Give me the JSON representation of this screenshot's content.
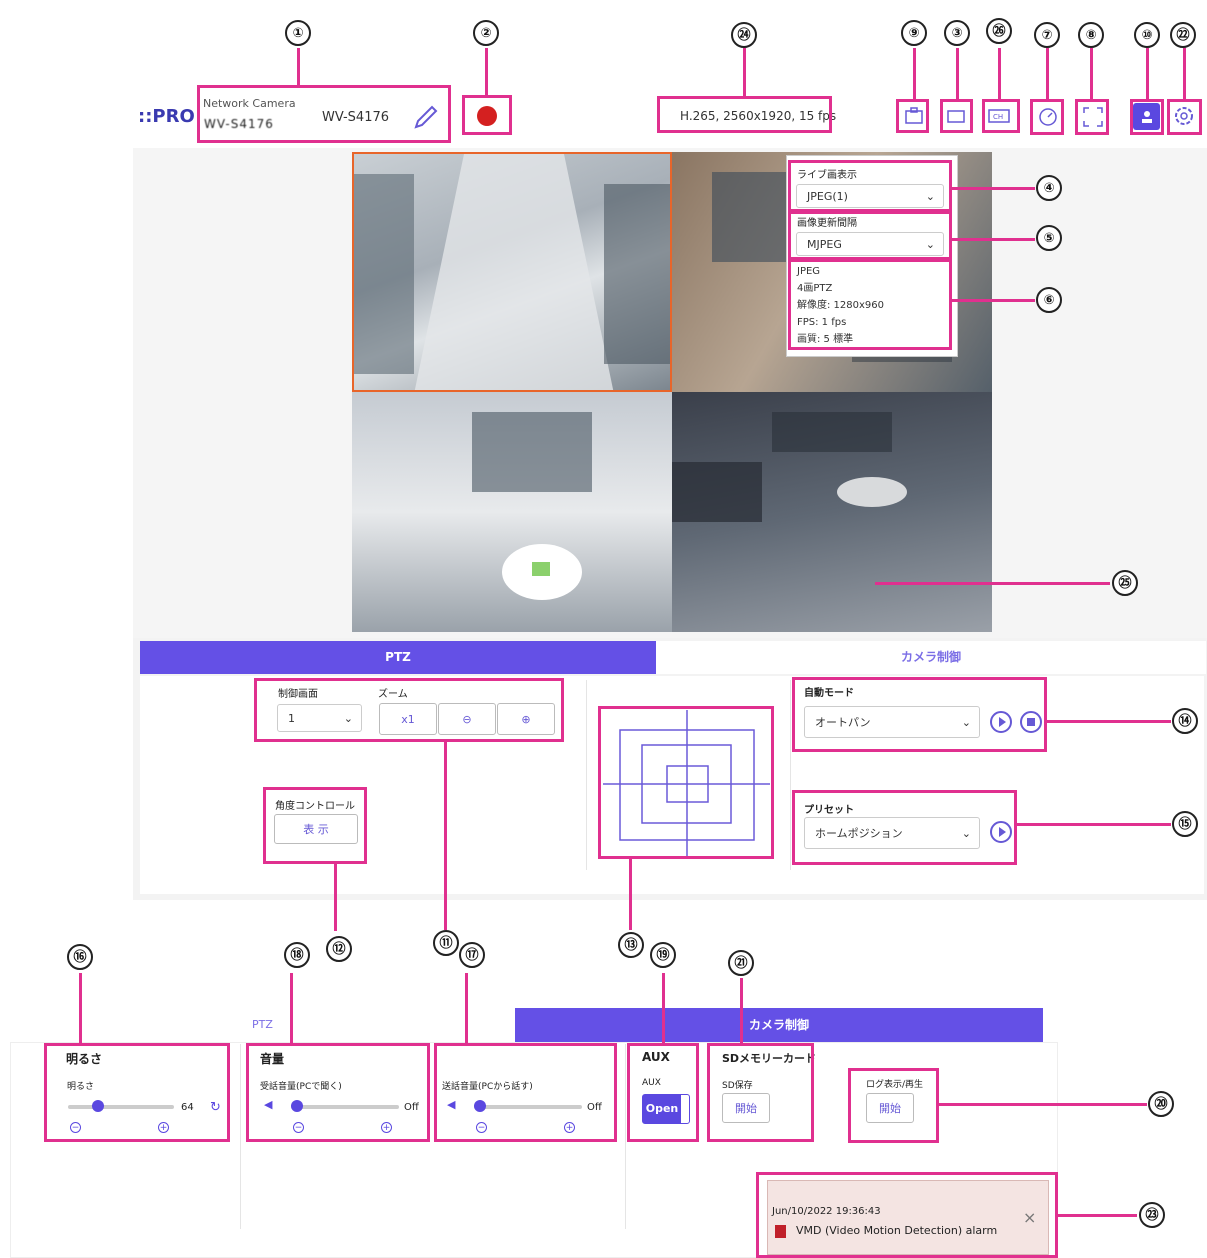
{
  "header": {
    "logo": "::PRO",
    "product_line": "Network Camera",
    "model_name": "WV-S4176",
    "camera_title_masked": "WV-S4176",
    "stream_info": "H.265, 2560x1920, 15 fps"
  },
  "stream_popup": {
    "live_label": "ライブ画表示",
    "live_value": "JPEG(1)",
    "interval_label": "画像更新間隔",
    "interval_value": "MJPEG",
    "info_lines": [
      "JPEG",
      "4画PTZ",
      "解像度: 1280x960",
      "FPS: 1 fps",
      "画質: 5 標準"
    ]
  },
  "tabs": {
    "ptz": "PTZ",
    "camera_control": "カメラ制御"
  },
  "ptz": {
    "control_screen_label": "制御画面",
    "control_screen_value": "1",
    "zoom_label": "ズーム",
    "zoom_x1": "x1",
    "angle_control_label": "角度コントロール",
    "angle_control_button": "表 示",
    "auto_mode_label": "自動モード",
    "auto_mode_value": "オートパン",
    "preset_label": "プリセット",
    "preset_value": "ホームポジション"
  },
  "camera_control": {
    "brightness_title": "明るさ",
    "brightness_label": "明るさ",
    "brightness_value": "64",
    "brightness_level": 0.3,
    "volume_title": "音量",
    "receive_label": "受話音量(PCで聞く)",
    "receive_value": "Off",
    "send_label": "送話音量(PCから話す)",
    "send_value": "Off",
    "aux_title": "AUX",
    "aux_label": "AUX",
    "aux_button": "Open",
    "sd_title": "SDメモリーカード",
    "sd_label": "SD保存",
    "sd_button": "開始",
    "log_label": "ログ表示/再生",
    "log_button": "開始"
  },
  "alarm": {
    "timestamp": "Jun/10/2022 19:36:43",
    "message": "VMD (Video Motion Detection) alarm"
  },
  "callouts": [
    "①",
    "②",
    "㉔",
    "⑨",
    "③",
    "㉖",
    "⑦",
    "⑧",
    "⑩",
    "㉒",
    "④",
    "⑤",
    "⑥",
    "㉕",
    "⑭",
    "⑮",
    "⑯",
    "⑱",
    "⑫",
    "⑪",
    "⑰",
    "⑬",
    "⑲",
    "㉑",
    "⑳",
    "㉓"
  ],
  "icons": [
    "edit-pencil-icon",
    "rec-status-icon",
    "snapshot-icon",
    "video-icon",
    "channel-icon",
    "speed-icon",
    "fullscreen-icon",
    "user-icon",
    "gear-icon",
    "zoom-in-icon",
    "zoom-out-icon",
    "play-icon",
    "stop-icon",
    "speaker-icon",
    "reset-icon",
    "alarm-flag-icon",
    "close-icon"
  ],
  "colors": {
    "accent": "#6450e6",
    "annotation": "#e0308f",
    "rec": "#d42020",
    "alarm_bg": "#f4e4e2"
  }
}
